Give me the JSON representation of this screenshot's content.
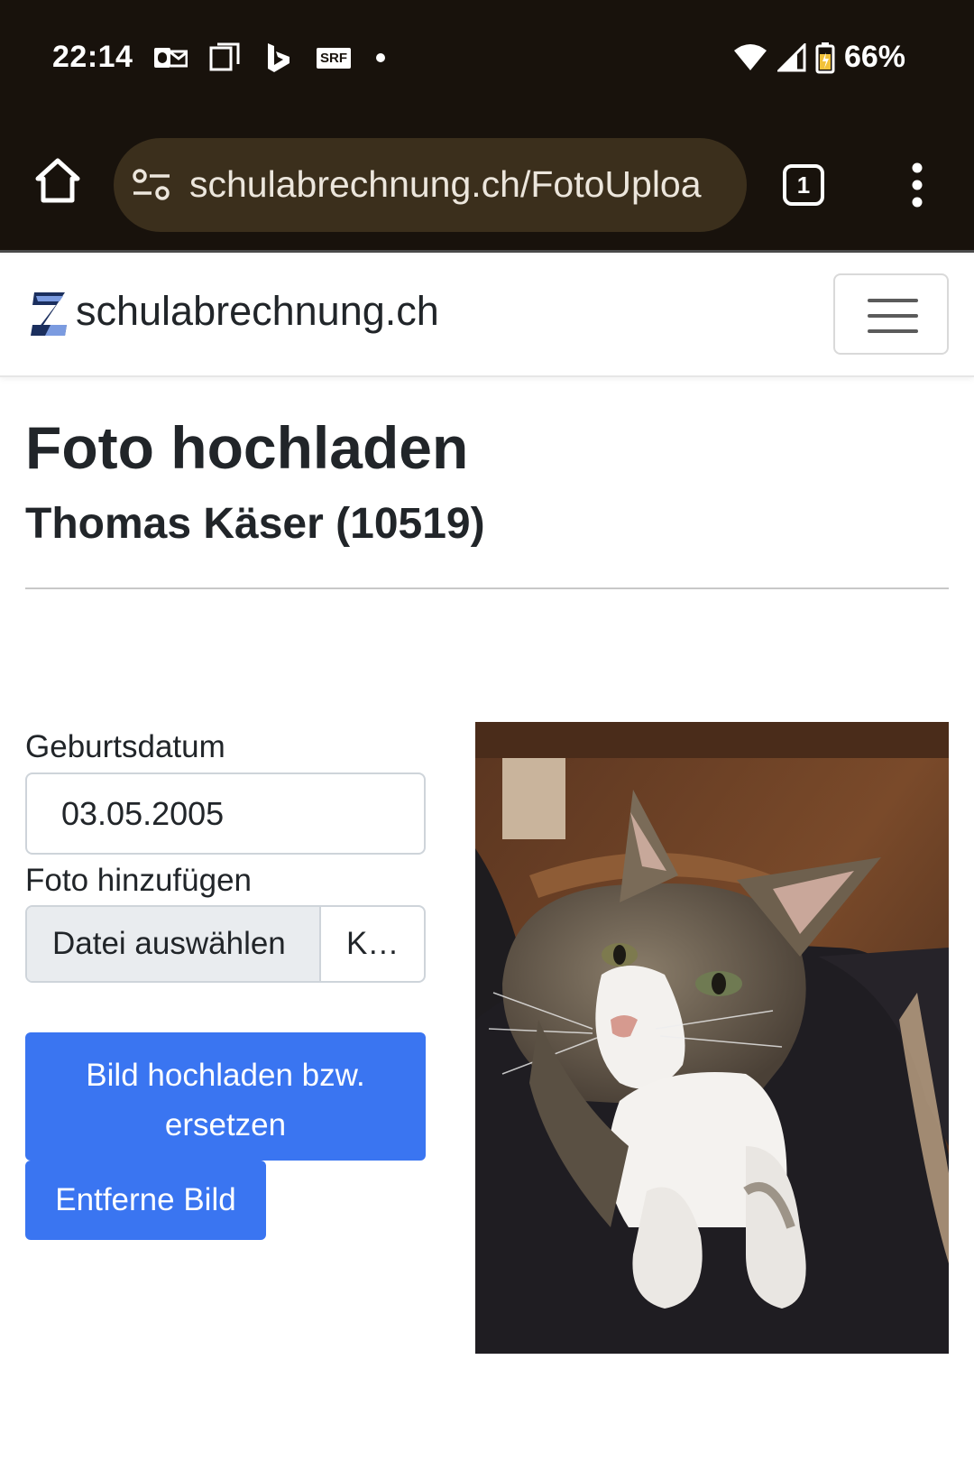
{
  "status_bar": {
    "time": "22:14",
    "left_icons": [
      "outlook-icon",
      "screen-icon",
      "bing-icon",
      "srf-icon",
      "dot-icon"
    ],
    "srf_label": "SRF",
    "battery_percent": "66%"
  },
  "browser": {
    "url": "schulabrechnung.ch/FotoUploa",
    "tab_count": "1"
  },
  "navbar": {
    "brand": "schulabrechnung.ch"
  },
  "page": {
    "title": "Foto hochladen",
    "subtitle": "Thomas Käser (10519)"
  },
  "form": {
    "dob_label": "Geburtsdatum",
    "dob_value": "03.05.2005",
    "photo_label": "Foto hinzufügen",
    "file_button": "Datei auswählen",
    "file_name": "K…",
    "upload_button": "Bild hochladen bzw. ersetzen",
    "remove_button": "Entferne Bild"
  },
  "colors": {
    "primary": "#3a75f1",
    "browser_chrome": "#18120c",
    "url_bar": "#3b2f1c"
  }
}
